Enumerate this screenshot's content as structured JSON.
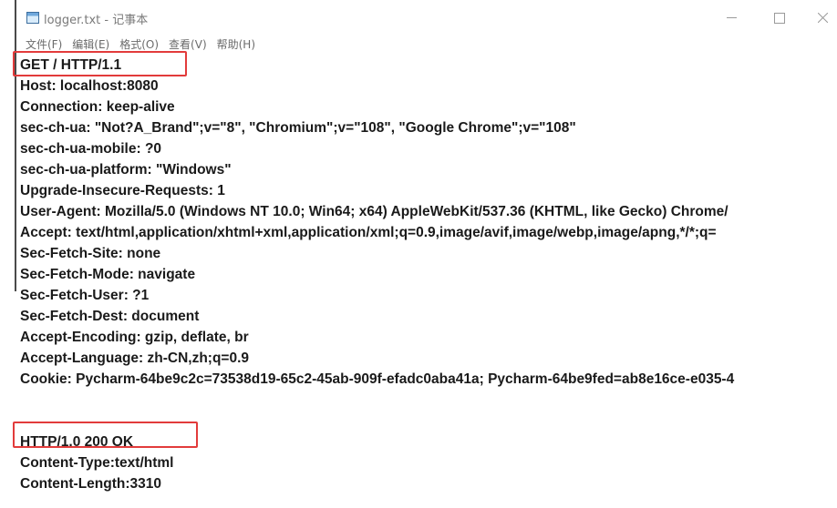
{
  "window": {
    "title": "logger.txt - 记事本",
    "controls": {
      "minimize": "minimize-icon",
      "maximize": "maximize-icon",
      "close": "close-icon"
    }
  },
  "menu": {
    "items": [
      {
        "label": "文件(F)"
      },
      {
        "label": "编辑(E)"
      },
      {
        "label": "格式(O)"
      },
      {
        "label": "查看(V)"
      },
      {
        "label": "帮助(H)"
      }
    ]
  },
  "document": {
    "lines": [
      "GET / HTTP/1.1",
      "Host: localhost:8080",
      "Connection: keep-alive",
      "sec-ch-ua: \"Not?A_Brand\";v=\"8\", \"Chromium\";v=\"108\", \"Google Chrome\";v=\"108\"",
      "sec-ch-ua-mobile: ?0",
      "sec-ch-ua-platform: \"Windows\"",
      "Upgrade-Insecure-Requests: 1",
      "User-Agent: Mozilla/5.0 (Windows NT 10.0; Win64; x64) AppleWebKit/537.36 (KHTML, like Gecko) Chrome/",
      "Accept: text/html,application/xhtml+xml,application/xml;q=0.9,image/avif,image/webp,image/apng,*/*;q=",
      "Sec-Fetch-Site: none",
      "Sec-Fetch-Mode: navigate",
      "Sec-Fetch-User: ?1",
      "Sec-Fetch-Dest: document",
      "Accept-Encoding: gzip, deflate, br",
      "Accept-Language: zh-CN,zh;q=0.9",
      "Cookie: Pycharm-64be9c2c=73538d19-65c2-45ab-909f-efadc0aba41a; Pycharm-64be9fed=ab8e16ce-e035-4",
      "",
      "",
      "HTTP/1.0 200 OK",
      "Content-Type:text/html",
      "Content-Length:3310"
    ]
  },
  "colors": {
    "highlight_border": "#e23b3b",
    "text": "#1a1a1a",
    "menu_text": "#6b6b6b"
  }
}
